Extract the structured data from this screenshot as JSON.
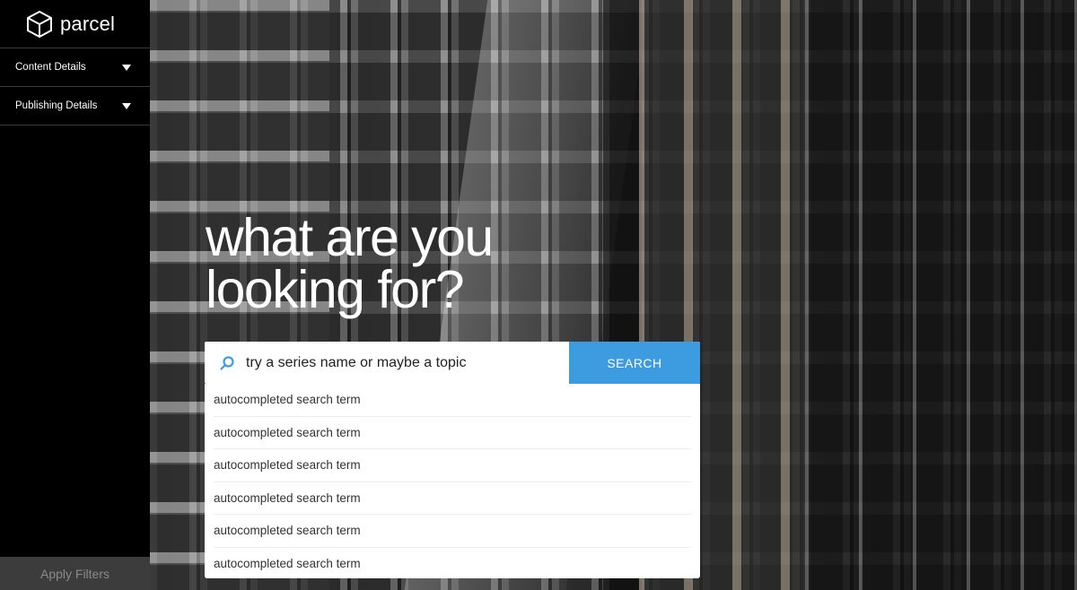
{
  "app": {
    "brand_name": "parcel",
    "logo_icon": "cube-icon"
  },
  "sidebar": {
    "filters": [
      {
        "label": "Content Details",
        "icon": "caret-down-icon"
      },
      {
        "label": "Publishing Details",
        "icon": "caret-down-icon"
      }
    ],
    "apply_label": "Apply Filters"
  },
  "hero": {
    "headline_line1": "what are you",
    "headline_line2": "looking for?"
  },
  "search": {
    "placeholder": "try a series name or maybe a topic",
    "button_label": "SEARCH",
    "icon": "search-icon",
    "accent_color": "#3d9be0",
    "suggestions": [
      "autocompleted search term",
      "autocompleted search term",
      "autocompleted search term",
      "autocompleted search term",
      "autocompleted search term",
      "autocompleted search term"
    ]
  }
}
